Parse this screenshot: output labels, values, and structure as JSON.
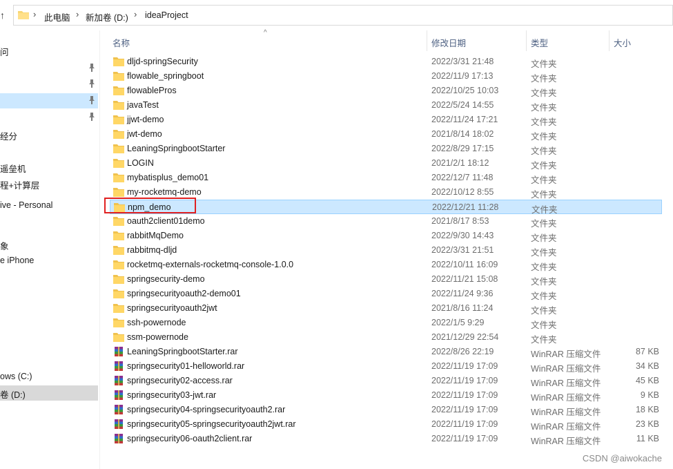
{
  "address": {
    "crumbs": [
      "此电脑",
      "新加卷 (D:)",
      "ideaProject"
    ]
  },
  "nav": {
    "items": [
      {
        "label": "问",
        "pin": false
      },
      {
        "label": "",
        "pin": true
      },
      {
        "label": "",
        "pin": true
      },
      {
        "label": "",
        "pin": true,
        "highlight": true
      },
      {
        "label": "",
        "pin": true
      },
      {
        "label": "经分",
        "pin": false
      },
      {
        "label": "遥垒机",
        "pin": false
      },
      {
        "label": "程+计算层",
        "pin": false
      },
      {
        "label": "ive - Personal",
        "pin": false
      },
      {
        "label": "象",
        "pin": false
      },
      {
        "label": "e iPhone",
        "pin": false
      },
      {
        "label": "ows (C:)",
        "pin": false
      },
      {
        "label": "卷 (D:)",
        "pin": false,
        "selected": true
      }
    ]
  },
  "columns": {
    "name": "名称",
    "date": "修改日期",
    "type": "类型",
    "size": "大小"
  },
  "files": [
    {
      "name": "dljd-springSecurity",
      "date": "2022/3/31 21:48",
      "type": "文件夹",
      "size": "",
      "kind": "folder"
    },
    {
      "name": "flowable_springboot",
      "date": "2022/11/9 17:13",
      "type": "文件夹",
      "size": "",
      "kind": "folder"
    },
    {
      "name": "flowablePros",
      "date": "2022/10/25 10:03",
      "type": "文件夹",
      "size": "",
      "kind": "folder"
    },
    {
      "name": "javaTest",
      "date": "2022/5/24 14:55",
      "type": "文件夹",
      "size": "",
      "kind": "folder"
    },
    {
      "name": "jjwt-demo",
      "date": "2022/11/24 17:21",
      "type": "文件夹",
      "size": "",
      "kind": "folder"
    },
    {
      "name": "jwt-demo",
      "date": "2021/8/14 18:02",
      "type": "文件夹",
      "size": "",
      "kind": "folder"
    },
    {
      "name": "LeaningSpringbootStarter",
      "date": "2022/8/29 17:15",
      "type": "文件夹",
      "size": "",
      "kind": "folder"
    },
    {
      "name": "LOGIN",
      "date": "2021/2/1 18:12",
      "type": "文件夹",
      "size": "",
      "kind": "folder"
    },
    {
      "name": "mybatisplus_demo01",
      "date": "2022/12/7 11:48",
      "type": "文件夹",
      "size": "",
      "kind": "folder"
    },
    {
      "name": "my-rocketmq-demo",
      "date": "2022/10/12 8:55",
      "type": "文件夹",
      "size": "",
      "kind": "folder"
    },
    {
      "name": "npm_demo",
      "date": "2022/12/21 11:28",
      "type": "文件夹",
      "size": "",
      "kind": "folder",
      "selected": true
    },
    {
      "name": "oauth2client01demo",
      "date": "2021/8/17 8:53",
      "type": "文件夹",
      "size": "",
      "kind": "folder"
    },
    {
      "name": "rabbitMqDemo",
      "date": "2022/9/30 14:43",
      "type": "文件夹",
      "size": "",
      "kind": "folder"
    },
    {
      "name": "rabbitmq-dljd",
      "date": "2022/3/31 21:51",
      "type": "文件夹",
      "size": "",
      "kind": "folder"
    },
    {
      "name": "rocketmq-externals-rocketmq-console-1.0.0",
      "date": "2022/10/11 16:09",
      "type": "文件夹",
      "size": "",
      "kind": "folder"
    },
    {
      "name": "springsecurity-demo",
      "date": "2022/11/21 15:08",
      "type": "文件夹",
      "size": "",
      "kind": "folder"
    },
    {
      "name": "springsecurityoauth2-demo01",
      "date": "2022/11/24 9:36",
      "type": "文件夹",
      "size": "",
      "kind": "folder"
    },
    {
      "name": "springsecurityoauth2jwt",
      "date": "2021/8/16 11:24",
      "type": "文件夹",
      "size": "",
      "kind": "folder"
    },
    {
      "name": "ssh-powernode",
      "date": "2022/1/5 9:29",
      "type": "文件夹",
      "size": "",
      "kind": "folder"
    },
    {
      "name": "ssm-powernode",
      "date": "2021/12/29 22:54",
      "type": "文件夹",
      "size": "",
      "kind": "folder"
    },
    {
      "name": "LeaningSpringbootStarter.rar",
      "date": "2022/8/26 22:19",
      "type": "WinRAR 压缩文件",
      "size": "87 KB",
      "kind": "rar"
    },
    {
      "name": "springsecurity01-helloworld.rar",
      "date": "2022/11/19 17:09",
      "type": "WinRAR 压缩文件",
      "size": "34 KB",
      "kind": "rar"
    },
    {
      "name": "springsecurity02-access.rar",
      "date": "2022/11/19 17:09",
      "type": "WinRAR 压缩文件",
      "size": "45 KB",
      "kind": "rar"
    },
    {
      "name": "springsecurity03-jwt.rar",
      "date": "2022/11/19 17:09",
      "type": "WinRAR 压缩文件",
      "size": "9 KB",
      "kind": "rar"
    },
    {
      "name": "springsecurity04-springsecurityoauth2.rar",
      "date": "2022/11/19 17:09",
      "type": "WinRAR 压缩文件",
      "size": "18 KB",
      "kind": "rar"
    },
    {
      "name": "springsecurity05-springsecurityoauth2jwt.rar",
      "date": "2022/11/19 17:09",
      "type": "WinRAR 压缩文件",
      "size": "23 KB",
      "kind": "rar"
    },
    {
      "name": "springsecurity06-oauth2client.rar",
      "date": "2022/11/19 17:09",
      "type": "WinRAR 压缩文件",
      "size": "11 KB",
      "kind": "rar"
    }
  ],
  "watermark": "CSDN @aiwokache",
  "colors": {
    "selection": "#cce8ff",
    "selection_border": "#99d1ff",
    "annotation": "#e02020",
    "folder": "#ffd766"
  },
  "icons": {
    "folder": "folder-icon",
    "rar": "winrar-archive-icon",
    "pin": "pin-icon",
    "up": "up-arrow-icon"
  }
}
